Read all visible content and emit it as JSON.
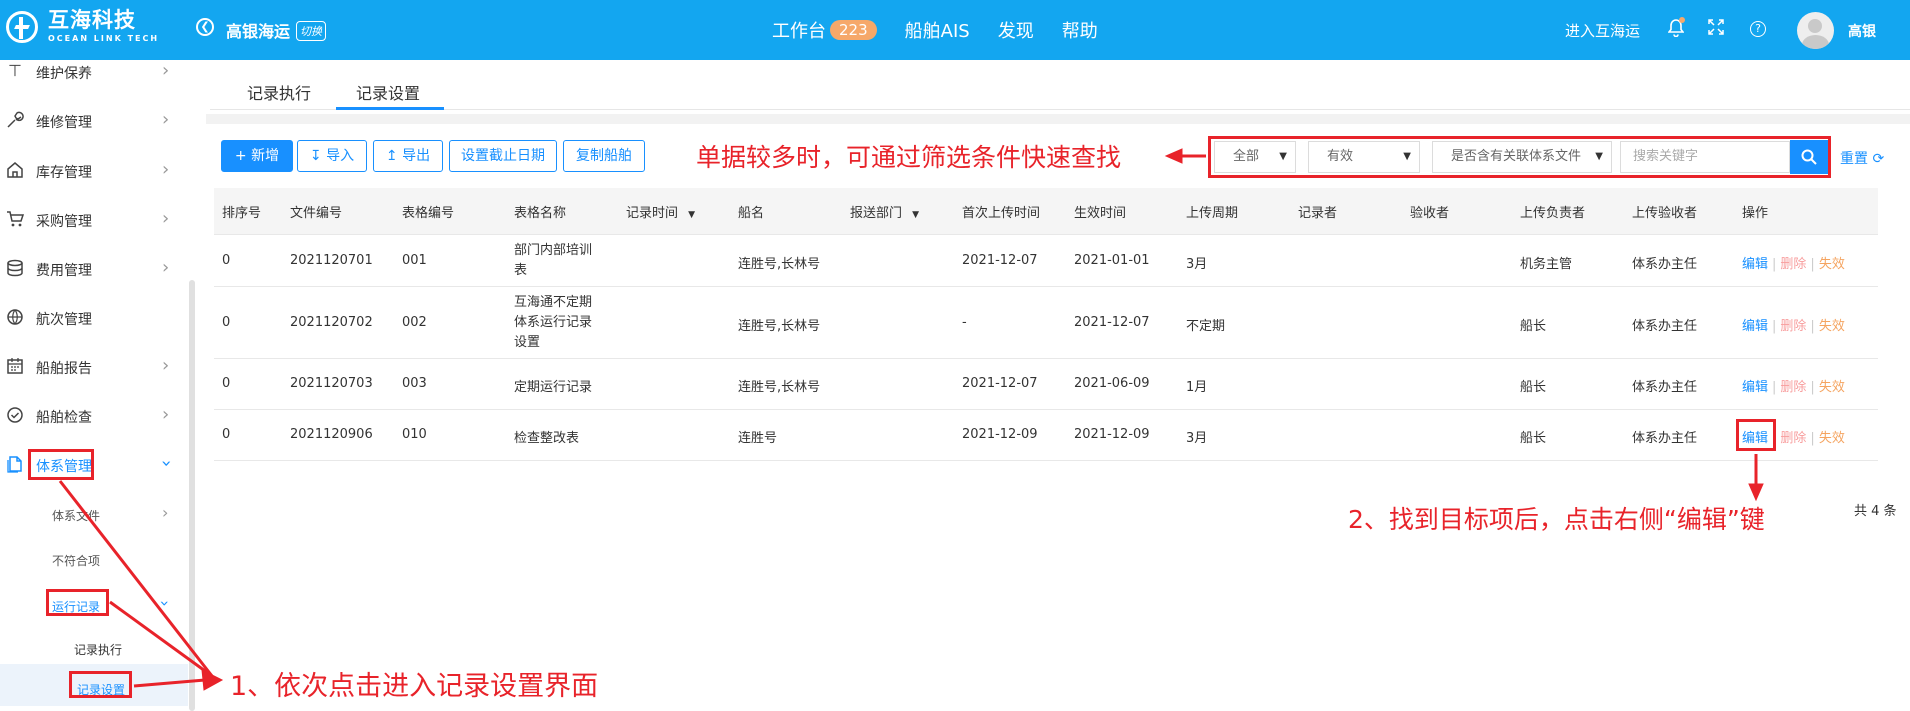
{
  "header": {
    "logo_cn": "互海科技",
    "logo_en": "OCEAN LINK TECH",
    "company": "高银海运",
    "switch_label": "切换",
    "nav": [
      {
        "label": "工作台",
        "badge": "223"
      },
      {
        "label": "船舶AIS"
      },
      {
        "label": "发现"
      },
      {
        "label": "帮助"
      }
    ],
    "enter_label": "进入互海运",
    "user_name": "高银"
  },
  "sidebar": {
    "items": [
      {
        "label": "维护保养",
        "icon": "hammer-icon"
      },
      {
        "label": "维修管理",
        "icon": "wrench-icon"
      },
      {
        "label": "库存管理",
        "icon": "home-icon"
      },
      {
        "label": "采购管理",
        "icon": "cart-icon"
      },
      {
        "label": "费用管理",
        "icon": "database-icon"
      },
      {
        "label": "航次管理",
        "icon": "globe-icon"
      },
      {
        "label": "船舶报告",
        "icon": "calendar-icon"
      },
      {
        "label": "船舶检查",
        "icon": "check-circle-icon"
      },
      {
        "label": "体系管理",
        "icon": "document-icon"
      }
    ],
    "sub_items": {
      "system_files": "体系文件",
      "nonconformity": "不符合项",
      "run_records": "运行记录",
      "record_execution": "记录执行",
      "record_settings": "记录设置"
    }
  },
  "tabs": [
    "记录执行",
    "记录设置"
  ],
  "toolbar": {
    "add": "+ 新增",
    "import": "导入",
    "export": "导出",
    "set_deadline": "设置截止日期",
    "copy_ship": "复制船舶"
  },
  "filters": {
    "scope": "全部",
    "validity": "有效",
    "linked": "是否含有关联体系文件",
    "search_placeholder": "搜索关键字",
    "reset": "重置"
  },
  "table": {
    "headers": [
      "排序号",
      "文件编号",
      "表格编号",
      "表格名称",
      "记录时间",
      "船名",
      "报送部门",
      "首次上传时间",
      "生效时间",
      "上传周期",
      "记录者",
      "验收者",
      "上传负责者",
      "上传验收者",
      "操作"
    ],
    "rows": [
      {
        "sort": "0",
        "file_no": "2021120701",
        "form_no": "001",
        "name": "部门内部培训表",
        "ship": "连胜号,长林号",
        "first_upload": "2021-12-07",
        "effective": "2021-01-01",
        "cycle": "3月",
        "uploader": "机务主管",
        "acceptor": "体系办主任"
      },
      {
        "sort": "0",
        "file_no": "2021120702",
        "form_no": "002",
        "name": "互海通不定期体系运行记录设置",
        "ship": "连胜号,长林号",
        "first_upload": "-",
        "effective": "2021-12-07",
        "cycle": "不定期",
        "uploader": "船长",
        "acceptor": "体系办主任"
      },
      {
        "sort": "0",
        "file_no": "2021120703",
        "form_no": "003",
        "name": "定期运行记录",
        "ship": "连胜号,长林号",
        "first_upload": "2021-12-07",
        "effective": "2021-06-09",
        "cycle": "1月",
        "uploader": "船长",
        "acceptor": "体系办主任"
      },
      {
        "sort": "0",
        "file_no": "2021120906",
        "form_no": "010",
        "name": "检查整改表",
        "ship": "连胜号",
        "first_upload": "2021-12-09",
        "effective": "2021-12-09",
        "cycle": "3月",
        "uploader": "船长",
        "acceptor": "体系办主任"
      }
    ],
    "ops": {
      "edit": "编辑",
      "delete": "删除",
      "invalidate": "失效"
    },
    "total": "共 4 条"
  },
  "annotations": {
    "filter_hint": "单据较多时，可通过筛选条件快速查找",
    "step1": "1、依次点击进入记录设置界面",
    "step2": "2、找到目标项后，点击右侧“编辑”键"
  },
  "colors": {
    "header": "#13a6f0",
    "primary": "#1890ff",
    "annotation": "#e8232a"
  }
}
